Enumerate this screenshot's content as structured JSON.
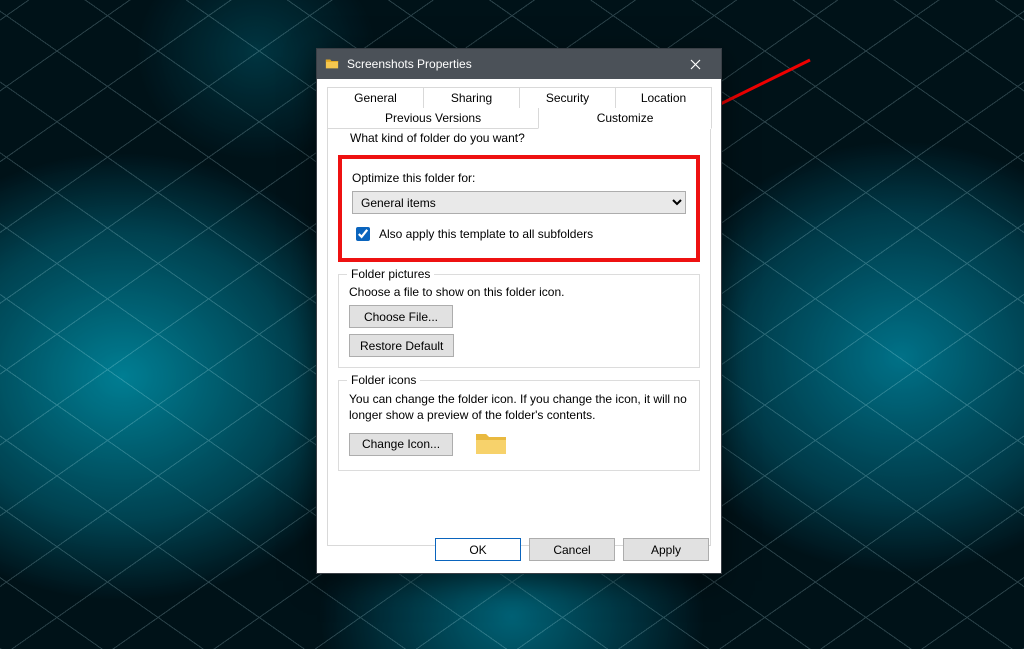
{
  "window": {
    "title": "Screenshots Properties"
  },
  "tabs": {
    "row1": [
      "General",
      "Sharing",
      "Security",
      "Location"
    ],
    "row2": [
      "Previous Versions",
      "Customize"
    ],
    "active": "Customize"
  },
  "customize": {
    "kind_heading": "What kind of folder do you want?",
    "optimize_label": "Optimize this folder for:",
    "optimize_value": "General items",
    "also_apply_label": "Also apply this template to all subfolders",
    "also_apply_checked": true,
    "folder_pictures": {
      "legend": "Folder pictures",
      "desc": "Choose a file to show on this folder icon.",
      "choose_file": "Choose File...",
      "restore_default": "Restore Default"
    },
    "folder_icons": {
      "legend": "Folder icons",
      "desc": "You can change the folder icon. If you change the icon, it will no longer show a preview of the folder's contents.",
      "change_icon": "Change Icon..."
    }
  },
  "footer": {
    "ok": "OK",
    "cancel": "Cancel",
    "apply": "Apply"
  },
  "annotation": {
    "highlight": "optimize-section",
    "arrow_target": "tab-customize"
  }
}
